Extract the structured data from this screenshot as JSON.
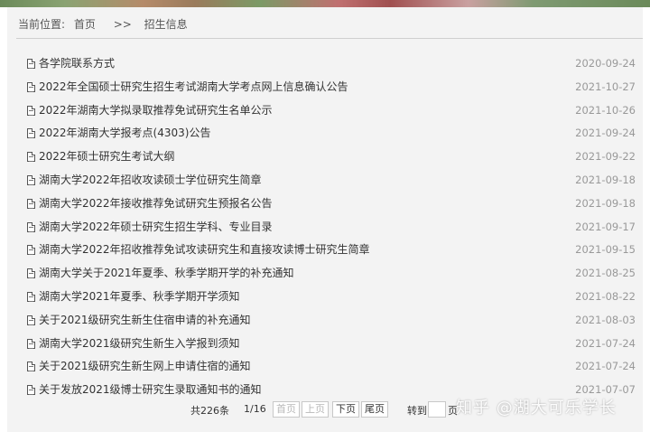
{
  "breadcrumb": {
    "label": "当前位置:",
    "home": "首页",
    "separator": ">>",
    "current": "招生信息"
  },
  "items": [
    {
      "title": "各学院联系方式",
      "date": "2020-09-24"
    },
    {
      "title": "2022年全国硕士研究生招生考试湖南大学考点网上信息确认公告",
      "date": "2021-10-27"
    },
    {
      "title": "2022年湖南大学拟录取推荐免试研究生名单公示",
      "date": "2021-10-26"
    },
    {
      "title": "2022年湖南大学报考点(4303)公告",
      "date": "2021-09-24"
    },
    {
      "title": "2022年硕士研究生考试大纲",
      "date": "2021-09-22"
    },
    {
      "title": "湖南大学2022年招收攻读硕士学位研究生简章",
      "date": "2021-09-18"
    },
    {
      "title": "湖南大学2022年接收推荐免试研究生预报名公告",
      "date": "2021-09-18"
    },
    {
      "title": "湖南大学2022年硕士研究生招生学科、专业目录",
      "date": "2021-09-17"
    },
    {
      "title": "湖南大学2022年招收推荐免试攻读研究生和直接攻读博士研究生简章",
      "date": "2021-09-15"
    },
    {
      "title": "湖南大学关于2021年夏季、秋季学期开学的补充通知",
      "date": "2021-08-25"
    },
    {
      "title": "湖南大学2021年夏季、秋季学期开学须知",
      "date": "2021-08-22"
    },
    {
      "title": "关于2021级研究生新生住宿申请的补充通知",
      "date": "2021-08-03"
    },
    {
      "title": "湖南大学2021级研究生新生入学报到须知",
      "date": "2021-07-24"
    },
    {
      "title": "关于2021级研究生新生网上申请住宿的通知",
      "date": "2021-07-24"
    },
    {
      "title": "关于发放2021级博士研究生录取通知书的通知",
      "date": "2021-07-07"
    }
  ],
  "pager": {
    "total": "共226条",
    "page_info": "1/16",
    "first": "首页",
    "prev": "上页",
    "next": "下页",
    "last": "尾页",
    "goto_label": "转到",
    "goto_value": "",
    "page_unit": "页"
  },
  "watermark": "知乎 @湖大可乐学长",
  "icons": {
    "doc": "document-icon"
  }
}
